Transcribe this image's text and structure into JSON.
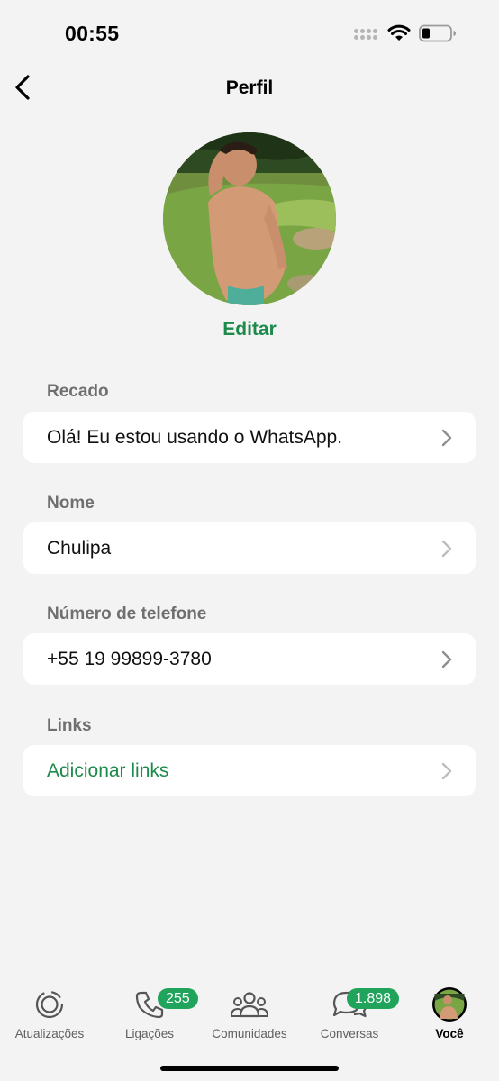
{
  "status_bar": {
    "time": "00:55"
  },
  "nav": {
    "title": "Perfil"
  },
  "profile": {
    "edit_label": "Editar"
  },
  "sections": [
    {
      "label": "Recado",
      "value": "Olá! Eu estou usando o WhatsApp."
    },
    {
      "label": "Nome",
      "value": "Chulipa"
    },
    {
      "label": "Número de telefone",
      "value": "+55 19 99899-3780"
    },
    {
      "label": "Links",
      "value": "Adicionar links"
    }
  ],
  "tabs": [
    {
      "label": "Atualizações",
      "icon": "updates-icon",
      "badge": ""
    },
    {
      "label": "Ligações",
      "icon": "phone-icon",
      "badge": "255"
    },
    {
      "label": "Comunidades",
      "icon": "communities-icon",
      "badge": ""
    },
    {
      "label": "Conversas",
      "icon": "chats-icon",
      "badge": "1.898"
    },
    {
      "label": "Você",
      "icon": "profile-avatar-icon",
      "badge": "",
      "active": true
    }
  ],
  "colors": {
    "accent": "#1b8a4b",
    "badge": "#20a35a",
    "background": "#f3f3f3"
  }
}
